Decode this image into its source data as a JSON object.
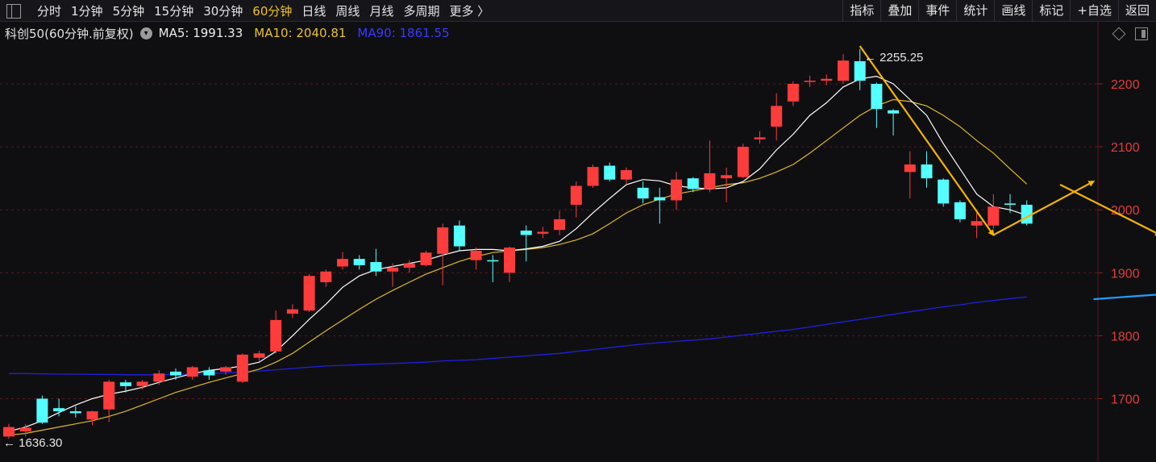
{
  "toolbar": {
    "periods": [
      "分时",
      "1分钟",
      "5分钟",
      "15分钟",
      "30分钟",
      "60分钟",
      "日线",
      "周线",
      "月线",
      "多周期",
      "更多 〉"
    ],
    "active_period": "60分钟",
    "tools": [
      "指标",
      "叠加",
      "事件",
      "统计",
      "画线",
      "标记",
      "+自选",
      "返回"
    ]
  },
  "legend": {
    "name": "科创50(60分钟.前复权)",
    "ma5": "MA5: 1991.33",
    "ma10": "MA10: 2040.81",
    "ma90": "MA90: 1861.55"
  },
  "colors": {
    "up": "#fe3c3c",
    "down": "#54ffff",
    "ma5": "#ffffff",
    "ma10": "#e0b81f",
    "ma90": "#2020e0",
    "arrow_yellow": "#f5b400",
    "arrow_blue": "#1f9fff",
    "axis_text": "#e03b3b",
    "grid": "#5a1a1a"
  },
  "chart_data": {
    "type": "candlestick",
    "ylim": [
      1630,
      2265
    ],
    "yticks": [
      1700,
      1800,
      1900,
      2000,
      2100,
      2200
    ],
    "annotations": {
      "high": "2255.25",
      "low": "1636.30"
    },
    "candles": [
      [
        1640,
        1655,
        1660,
        1636.3
      ],
      [
        1648,
        1654,
        1660,
        1640
      ],
      [
        1700,
        1662,
        1705,
        1660
      ],
      [
        1685,
        1680,
        1700,
        1672
      ],
      [
        1680,
        1677,
        1688,
        1670
      ],
      [
        1667,
        1680,
        1681,
        1658
      ],
      [
        1683,
        1727,
        1730,
        1663
      ],
      [
        1726,
        1720,
        1730,
        1710
      ],
      [
        1720,
        1727,
        1730,
        1715
      ],
      [
        1727,
        1740,
        1745,
        1722
      ],
      [
        1743,
        1737,
        1748,
        1730
      ],
      [
        1735,
        1750,
        1752,
        1730
      ],
      [
        1745,
        1737,
        1750,
        1730
      ],
      [
        1743,
        1750,
        1752,
        1738
      ],
      [
        1727,
        1770,
        1772,
        1725
      ],
      [
        1765,
        1772,
        1776,
        1760
      ],
      [
        1775,
        1825,
        1840,
        1772
      ],
      [
        1835,
        1842,
        1850,
        1828
      ],
      [
        1840,
        1895,
        1898,
        1838
      ],
      [
        1885,
        1902,
        1905,
        1878
      ],
      [
        1910,
        1922,
        1933,
        1905
      ],
      [
        1922,
        1912,
        1928,
        1905
      ],
      [
        1917,
        1902,
        1938,
        1895
      ],
      [
        1902,
        1908,
        1915,
        1878
      ],
      [
        1908,
        1915,
        1920,
        1900
      ],
      [
        1912,
        1932,
        1935,
        1910
      ],
      [
        1930,
        1972,
        1978,
        1880
      ],
      [
        1975,
        1942,
        1983,
        1935
      ],
      [
        1920,
        1935,
        1940,
        1905
      ],
      [
        1920,
        1918,
        1928,
        1885
      ],
      [
        1900,
        1940,
        1942,
        1885
      ],
      [
        1967,
        1960,
        1975,
        1918
      ],
      [
        1962,
        1965,
        1973,
        1955
      ],
      [
        1968,
        1985,
        1998,
        1960
      ],
      [
        2008,
        2038,
        2045,
        1988
      ],
      [
        2038,
        2068,
        2072,
        2035
      ],
      [
        2070,
        2048,
        2075,
        2045
      ],
      [
        2048,
        2063,
        2067,
        2040
      ],
      [
        2035,
        2018,
        2045,
        2010
      ],
      [
        2020,
        2015,
        2035,
        1978
      ],
      [
        2015,
        2048,
        2060,
        2000
      ],
      [
        2050,
        2033,
        2052,
        2028
      ],
      [
        2033,
        2058,
        2110,
        2028
      ],
      [
        2050,
        2055,
        2067,
        2012
      ],
      [
        2052,
        2100,
        2105,
        2050
      ],
      [
        2112,
        2115,
        2125,
        2105
      ],
      [
        2132,
        2165,
        2185,
        2110
      ],
      [
        2172,
        2200,
        2204,
        2165
      ],
      [
        2204,
        2205,
        2213,
        2195
      ],
      [
        2205,
        2208,
        2215,
        2198
      ],
      [
        2205,
        2237,
        2247,
        2200
      ],
      [
        2236,
        2205,
        2255.25,
        2190
      ],
      [
        2200,
        2160,
        2202,
        2130
      ],
      [
        2158,
        2153,
        2160,
        2118
      ],
      [
        2060,
        2072,
        2093,
        2018
      ],
      [
        2072,
        2050,
        2093,
        2035
      ],
      [
        2048,
        2010,
        2050,
        2005
      ],
      [
        2012,
        1985,
        2015,
        1980
      ],
      [
        1975,
        1982,
        1995,
        1955
      ],
      [
        1975,
        2005,
        2025,
        1970
      ],
      [
        2010,
        2008,
        2025,
        1995
      ],
      [
        2008,
        1978,
        2015,
        1975
      ]
    ],
    "ma5": [
      1648,
      1655,
      1665,
      1678,
      1690,
      1700,
      1707,
      1712,
      1718,
      1726,
      1733,
      1740,
      1745,
      1748,
      1752,
      1758,
      1775,
      1800,
      1826,
      1850,
      1877,
      1895,
      1905,
      1910,
      1915,
      1920,
      1928,
      1935,
      1937,
      1937,
      1935,
      1938,
      1942,
      1950,
      1970,
      1995,
      2018,
      2040,
      2048,
      2046,
      2038,
      2035,
      2033,
      2035,
      2045,
      2065,
      2095,
      2120,
      2150,
      2170,
      2195,
      2208,
      2212,
      2200,
      2175,
      2150,
      2105,
      2065,
      2025,
      2005,
      2000,
      1991.33
    ],
    "ma10": [
      1642,
      1645,
      1650,
      1655,
      1660,
      1665,
      1672,
      1680,
      1690,
      1700,
      1710,
      1718,
      1726,
      1733,
      1740,
      1747,
      1758,
      1772,
      1790,
      1808,
      1825,
      1842,
      1858,
      1872,
      1885,
      1898,
      1908,
      1918,
      1926,
      1932,
      1935,
      1937,
      1940,
      1945,
      1952,
      1962,
      1978,
      1995,
      2008,
      2017,
      2025,
      2030,
      2035,
      2040,
      2043,
      2050,
      2060,
      2072,
      2090,
      2110,
      2130,
      2150,
      2165,
      2175,
      2172,
      2165,
      2150,
      2132,
      2110,
      2090,
      2065,
      2040.81
    ],
    "ma90": [
      1740,
      1740,
      1739.5,
      1739,
      1739,
      1738.5,
      1738.5,
      1738,
      1738,
      1738,
      1738.5,
      1739,
      1740,
      1741,
      1742,
      1744,
      1746,
      1748,
      1750,
      1752,
      1753,
      1754,
      1755,
      1756,
      1757,
      1758,
      1760,
      1761,
      1762,
      1764,
      1766,
      1768,
      1770,
      1772,
      1775,
      1778,
      1781,
      1784,
      1787,
      1789,
      1791,
      1793,
      1795,
      1798,
      1801,
      1804,
      1807,
      1810,
      1814,
      1818,
      1822,
      1826,
      1830,
      1834,
      1838,
      1842,
      1846,
      1849,
      1853,
      1856,
      1859,
      1861.55
    ],
    "drawn_arrows_yellow": [
      [
        [
          51,
          2260
        ],
        [
          59,
          1960
        ]
      ],
      [
        [
          59,
          1960
        ],
        [
          65,
          2045
        ]
      ],
      [
        [
          63,
          2040
        ],
        [
          69,
          1960
        ]
      ],
      [
        [
          69,
          1960
        ],
        [
          72,
          2040
        ]
      ],
      [
        [
          75,
          2035
        ],
        [
          78,
          1855
        ]
      ]
    ],
    "drawn_arrows_blue": [
      [
        [
          65,
          1858
        ],
        [
          79,
          1885
        ]
      ]
    ]
  }
}
